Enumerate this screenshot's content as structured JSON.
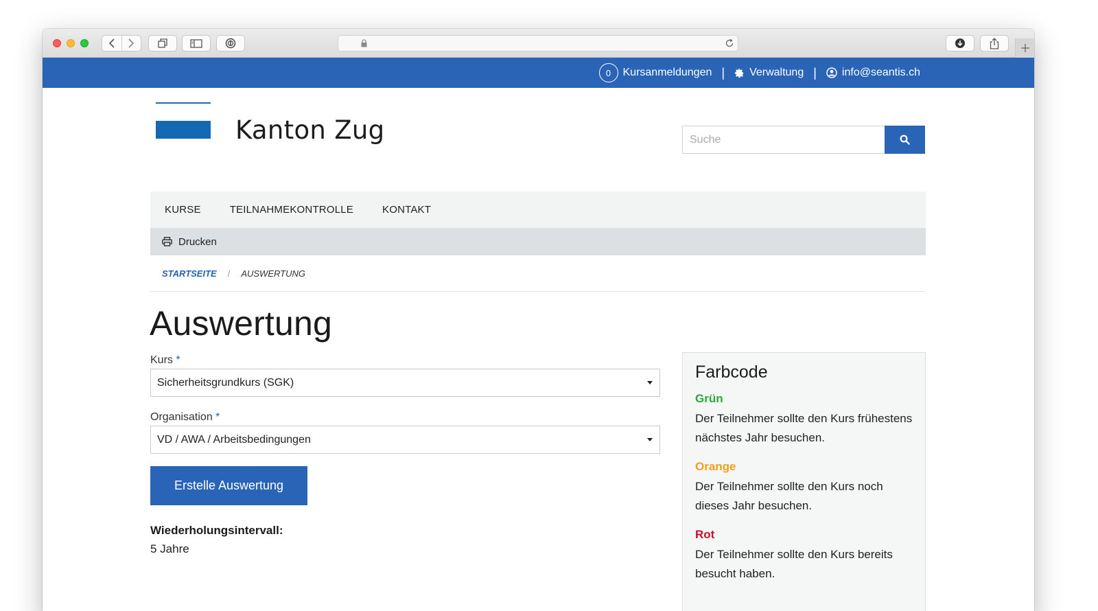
{
  "browser": {
    "url": "",
    "icons": [
      "back-icon",
      "forward-icon",
      "tabs-icon",
      "sidebar-icon",
      "password-icon",
      "lock-icon",
      "reload-icon",
      "download-icon",
      "share-icon",
      "plus-icon"
    ]
  },
  "topbar": {
    "cart_count": "0",
    "cart_label": "Kursanmeldungen",
    "admin_label": "Verwaltung",
    "user_label": "info@seantis.ch",
    "color": "#2964b7"
  },
  "header": {
    "logo_text": "Kanton Zug",
    "logo_color": "#1569b2",
    "search_placeholder": "Suche"
  },
  "mainnav": {
    "items": [
      {
        "label": "KURSE"
      },
      {
        "label": "TEILNAHMEKONTROLLE"
      },
      {
        "label": "KONTAKT"
      }
    ]
  },
  "tools": {
    "print_label": "Drucken"
  },
  "breadcrumb": {
    "home": "STARTSEITE",
    "separator": "/",
    "current": "AUSWERTUNG"
  },
  "page": {
    "title": "Auswertung"
  },
  "form": {
    "course_label": "Kurs",
    "course_required": "*",
    "course_value": "Sicherheitsgrundkurs (SGK)",
    "org_label": "Organisation",
    "org_required": "*",
    "org_value": "VD / AWA / Arbeitsbedingungen",
    "submit_label": "Erstelle Auswertung",
    "interval_label": "Wiederholungsintervall:",
    "interval_value": "5 Jahre"
  },
  "colorcode": {
    "title": "Farbcode",
    "items": [
      {
        "name": "Grün",
        "color": "#2aa83a",
        "desc": "Der Teilnehmer sollte den Kurs frühestens nächstes Jahr besuchen."
      },
      {
        "name": "Orange",
        "color": "#f0a01c",
        "desc": "Der Teilnehmer sollte den Kurs noch dieses Jahr besuchen."
      },
      {
        "name": "Rot",
        "color": "#c8102e",
        "desc": "Der Teilnehmer sollte den Kurs bereits besucht haben."
      }
    ]
  }
}
